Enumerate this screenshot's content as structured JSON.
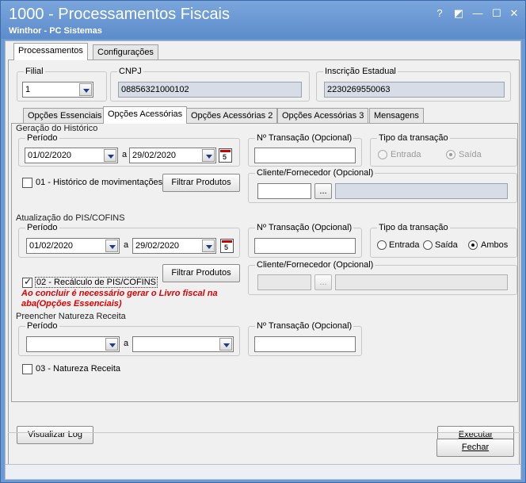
{
  "window": {
    "title": "1000 - Processamentos Fiscais",
    "subtitle": "Winthor - PC Sistemas",
    "help": "?",
    "restore": "◩",
    "minimize": "—",
    "maximize": "☐",
    "close": "✕"
  },
  "main_tabs": [
    {
      "label": "Processamentos",
      "active": true
    },
    {
      "label": "Configurações",
      "active": false
    }
  ],
  "header": {
    "filial_label": "Filial",
    "filial_value": "1",
    "cnpj_label": "CNPJ",
    "cnpj_value": "08856321000102",
    "ie_label": "Inscrição Estadual",
    "ie_value": "2230269550063"
  },
  "sub_tabs": [
    {
      "label": "Opções Essenciais"
    },
    {
      "label": "Opções Acessórias"
    },
    {
      "label": "Opções Acessórias 2"
    },
    {
      "label": "Opções Acessórias 3"
    },
    {
      "label": "Mensagens"
    }
  ],
  "historico": {
    "section": "Geração do Histórico",
    "periodo_label": "Período",
    "date_from": "01/02/2020",
    "a_label": "a",
    "date_to": "29/02/2020",
    "transacao_label": "Nº Transação (Opcional)",
    "transacao_value": "",
    "tipo_label": "Tipo da transação",
    "entrada": "Entrada",
    "saida": "Saída",
    "check_label": "01 - Histórico de movimentações",
    "filtrar": "Filtrar Produtos",
    "cliente_label": "Cliente/Fornecedor (Opcional)",
    "ellipsis": "..."
  },
  "pis": {
    "section": "Atualização do PIS/COFINS",
    "periodo_label": "Período",
    "date_from": "01/02/2020",
    "a_label": "a",
    "date_to": "29/02/2020",
    "transacao_label": "Nº Transação (Opcional)",
    "tipo_label": "Tipo da transação",
    "entrada": "Entrada",
    "saida": "Saída",
    "ambos": "Ambos",
    "filtrar": "Filtrar Produtos",
    "check_label": "02 - Recálculo de PIS/COFINS",
    "warning_line1": "Ao concluir é necessário gerar o Livro fiscal na",
    "warning_line2": "aba(Opções Essenciais)",
    "cliente_label": "Cliente/Fornecedor (Opcional)",
    "ellipsis": "..."
  },
  "natureza": {
    "section": "Preencher Natureza Receita",
    "periodo_label": "Período",
    "a_label": "a",
    "transacao_label": "Nº Transação (Opcional)",
    "check_label": "03 - Natureza Receita"
  },
  "buttons": {
    "visualizar_log": "Visualizar Log",
    "executar": "Executar",
    "fechar": "Fechar"
  }
}
